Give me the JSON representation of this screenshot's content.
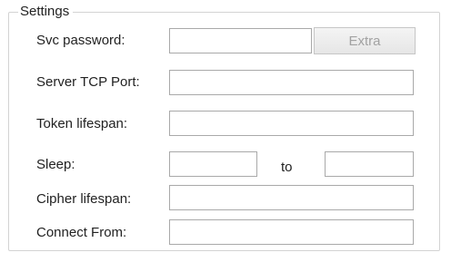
{
  "settings": {
    "group_title": "Settings",
    "svc_password": {
      "label": "Svc password:",
      "value": ""
    },
    "extra_button": {
      "label": "Extra",
      "enabled": false
    },
    "server_tcp_port": {
      "label": "Server TCP Port:",
      "value": ""
    },
    "token_lifespan": {
      "label": "Token lifespan:",
      "value": ""
    },
    "sleep": {
      "label": "Sleep:",
      "from_value": "",
      "to_label": "to",
      "to_value": ""
    },
    "cipher_lifespan": {
      "label": "Cipher lifespan:",
      "value": ""
    },
    "connect_from": {
      "label": "Connect From:",
      "value": ""
    }
  },
  "colors": {
    "group_border": "#d3d3d3",
    "field_border": "#a9a9a9",
    "disabled_text": "#a2a2a2"
  }
}
